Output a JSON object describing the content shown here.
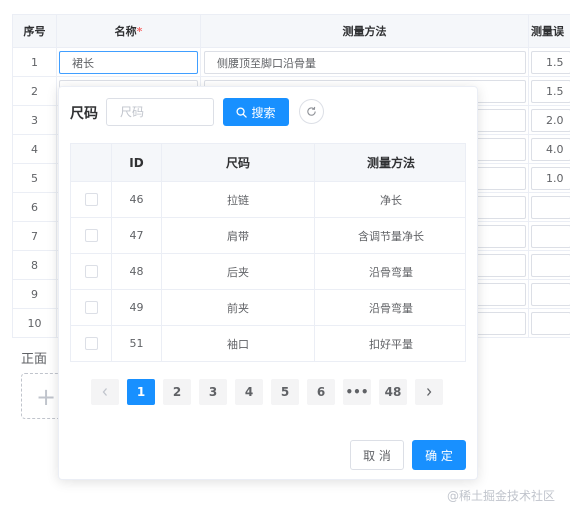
{
  "table": {
    "headers": {
      "seq": "序号",
      "name": "名称",
      "name_required": "*",
      "method": "测量方法",
      "error": "测量误"
    },
    "rows": [
      {
        "seq": "1",
        "name": "裙长",
        "method": "侧腰顶至脚口沿骨量",
        "error": "1.5"
      },
      {
        "seq": "2",
        "name": "",
        "method": "",
        "error": "1.5"
      },
      {
        "seq": "3",
        "name": "",
        "method": "",
        "error": "2.0"
      },
      {
        "seq": "4",
        "name": "",
        "method": "",
        "error": "4.0"
      },
      {
        "seq": "5",
        "name": "",
        "method": "",
        "error": "1.0"
      },
      {
        "seq": "6",
        "name": "",
        "method": "",
        "error": ""
      },
      {
        "seq": "7",
        "name": "",
        "method": "",
        "error": ""
      },
      {
        "seq": "8",
        "name": "",
        "method": "",
        "error": ""
      },
      {
        "seq": "9",
        "name": "",
        "method": "",
        "error": ""
      },
      {
        "seq": "10",
        "name": "",
        "method": "",
        "error": ""
      }
    ]
  },
  "front": {
    "label": "正面"
  },
  "popover": {
    "search_label": "尺码",
    "search_placeholder": "尺码",
    "search_button": "搜索",
    "columns": {
      "id": "ID",
      "size": "尺码",
      "method": "测量方法"
    },
    "rows": [
      {
        "id": "46",
        "size": "拉链",
        "method": "净长"
      },
      {
        "id": "47",
        "size": "肩带",
        "method": "含调节量净长"
      },
      {
        "id": "48",
        "size": "后夹",
        "method": "沿骨弯量"
      },
      {
        "id": "49",
        "size": "前夹",
        "method": "沿骨弯量"
      },
      {
        "id": "51",
        "size": "袖口",
        "method": "扣好平量"
      }
    ],
    "pagination": {
      "pages": [
        "1",
        "2",
        "3",
        "4",
        "5",
        "6"
      ],
      "ellipsis": "•••",
      "last": "48",
      "current": "1"
    },
    "cancel": "取 消",
    "confirm": "确 定"
  },
  "watermark": "@稀土掘金技术社区",
  "colors": {
    "primary": "#1890ff",
    "required": "#f56c6c",
    "border": "#ebeef5"
  }
}
